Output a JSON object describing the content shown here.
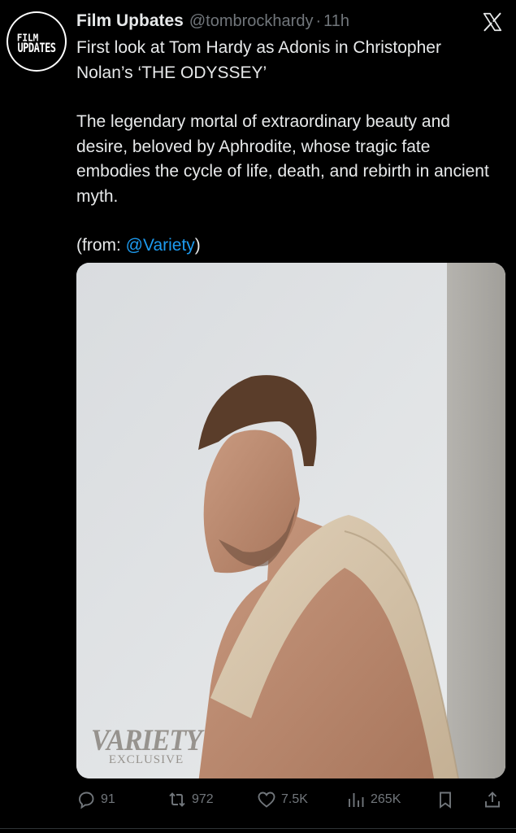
{
  "author": {
    "avatar_line1": "FILM",
    "avatar_line2": "UPDATES",
    "display_name": "Film Upbates",
    "handle": "@tombrockhardy",
    "separator": "·",
    "time": "11h"
  },
  "post": {
    "headline_line1": "First look at Tom Hardy as Adonis in Christopher",
    "headline_line2": "Nolan’s ‘THE ODYSSEY’",
    "description": "The legendary mortal of extraordinary beauty and desire, beloved by Aphrodite, whose tragic fate embodies the cycle of life, death, and rebirth in ancient myth.",
    "source_prefix": "(from: ",
    "source_mention": "@Variety",
    "source_suffix": ")"
  },
  "media": {
    "watermark_logo": "VARIETY",
    "watermark_sub": "EXCLUSIVE"
  },
  "actions": {
    "replies": "91",
    "reposts": "972",
    "likes": "7.5K",
    "views": "265K"
  },
  "icons": {
    "close": "x-logo-icon",
    "reply": "reply-icon",
    "repost": "repost-icon",
    "like": "heart-icon",
    "views": "views-icon",
    "bookmark": "bookmark-icon",
    "share": "share-icon"
  },
  "colors": {
    "background": "#000000",
    "text": "#e7e9ea",
    "muted": "#71767b",
    "link": "#1d9bf0"
  }
}
